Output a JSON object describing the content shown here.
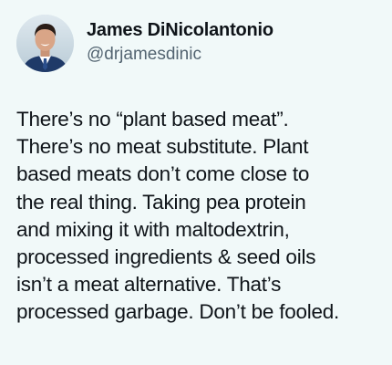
{
  "author": {
    "display_name": "James DiNicolantonio",
    "handle": "@drjamesdinic",
    "avatar_icon": "profile-photo"
  },
  "tweet": {
    "lines": [
      "There’s no “plant based meat”.",
      "There’s no meat substitute. Plant",
      "based meats don’t come close to",
      "the real thing. Taking pea protein",
      "and mixing it with maltodextrin,",
      "processed ingredients & seed oils",
      "isn’t a meat alternative. That’s",
      "processed garbage. Don’t be fooled."
    ]
  },
  "colors": {
    "background": "#f1f9f9",
    "text": "#0f1419",
    "handle": "#536471"
  }
}
